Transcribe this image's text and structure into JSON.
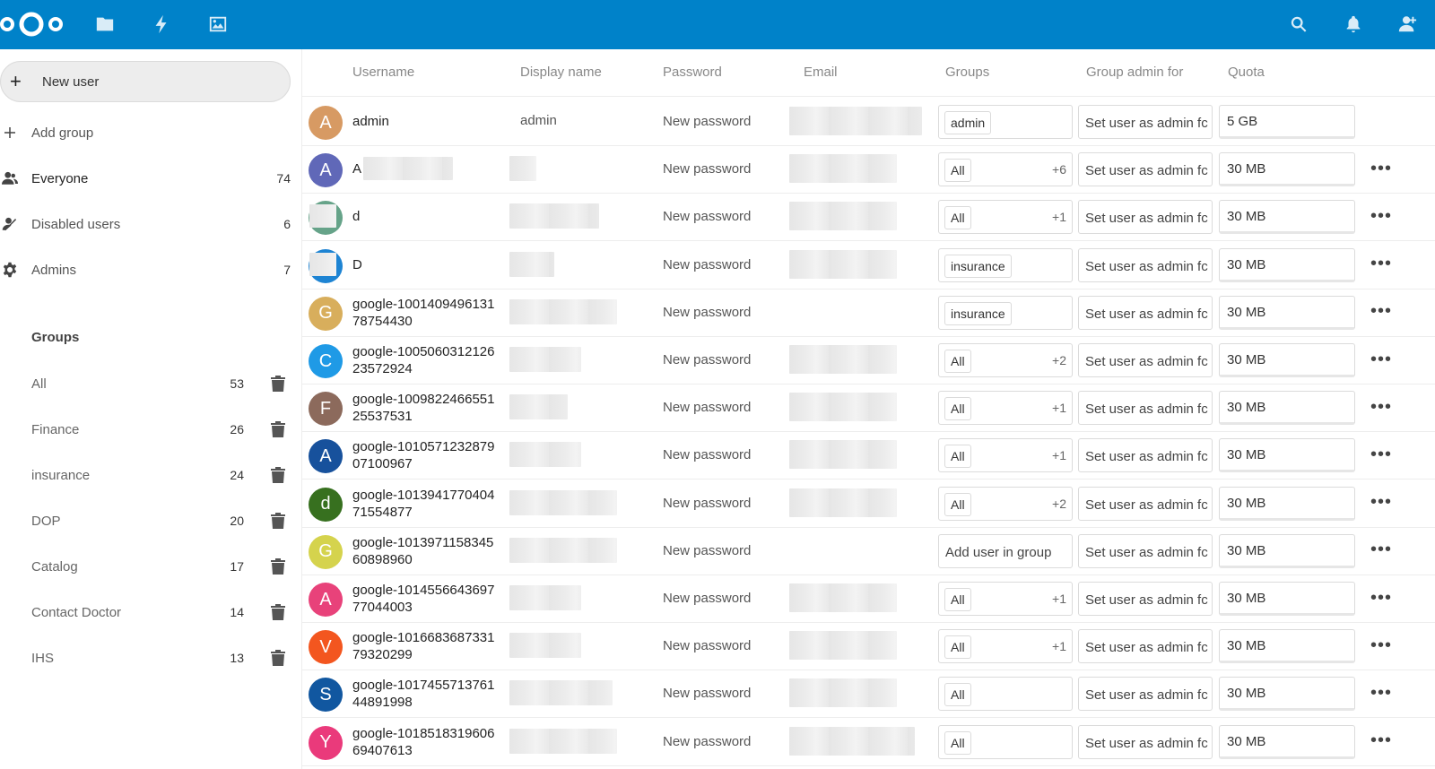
{
  "header": {
    "icons": [
      "nextcloud-logo",
      "files-icon",
      "activity-icon",
      "gallery-icon",
      "search-icon",
      "notifications-icon",
      "contacts-icon"
    ]
  },
  "sidebar": {
    "new_user": "New user",
    "add_group": "Add group",
    "items": [
      {
        "label": "Everyone",
        "count": "74",
        "icon": "user-icon"
      },
      {
        "label": "Disabled users",
        "count": "6",
        "icon": "disabled-user-icon"
      },
      {
        "label": "Admins",
        "count": "7",
        "icon": "gear-icon"
      }
    ],
    "groups_caption": "Groups",
    "groups": [
      {
        "label": "All",
        "count": "53"
      },
      {
        "label": "Finance",
        "count": "26"
      },
      {
        "label": "insurance",
        "count": "24"
      },
      {
        "label": "DOP",
        "count": "20"
      },
      {
        "label": "Catalog",
        "count": "17"
      },
      {
        "label": "Contact Doctor",
        "count": "14"
      },
      {
        "label": "IHS",
        "count": "13"
      }
    ]
  },
  "table": {
    "headers": [
      "Username",
      "Display name",
      "Password",
      "Email",
      "Groups",
      "Group admin for",
      "Quota"
    ],
    "rows": [
      {
        "avatar": "A",
        "color": "#d79a63",
        "user1": "admin",
        "user2": "",
        "display": "admin",
        "password": "New password",
        "group": "admin",
        "more": "",
        "admin": "Set user as admin fc",
        "quota": "5 GB"
      },
      {
        "avatar": "A",
        "color": "#6068b8",
        "user1": "A",
        "user2": "",
        "display": "",
        "password": "New password",
        "group": "All",
        "more": "+6",
        "admin": "Set user as admin fc",
        "quota": "30 MB"
      },
      {
        "avatar": "D",
        "color": "#66a389",
        "user1": "d",
        "user2": "",
        "display": "",
        "password": "New password",
        "group": "All",
        "more": "+1",
        "admin": "Set user as admin fc",
        "quota": "30 MB"
      },
      {
        "avatar": "D",
        "color": "#1e84d3",
        "user1": "D",
        "user2": "",
        "display": "",
        "password": "New password",
        "group": "insurance",
        "more": "",
        "admin": "Set user as admin fc",
        "quota": "30 MB"
      },
      {
        "avatar": "G",
        "color": "#d8ae5c",
        "user1": "google-1001409496131",
        "user2": "78754430",
        "display": "",
        "password": "New password",
        "group": "insurance",
        "more": "",
        "admin": "Set user as admin fc",
        "quota": "30 MB"
      },
      {
        "avatar": "C",
        "color": "#1f9ae6",
        "user1": "google-1005060312126",
        "user2": "23572924",
        "display": "",
        "password": "New password",
        "group": "All",
        "more": "+2",
        "admin": "Set user as admin fc",
        "quota": "30 MB"
      },
      {
        "avatar": "F",
        "color": "#8c6a5c",
        "user1": "google-1009822466551",
        "user2": "25537531",
        "display": "",
        "password": "New password",
        "group": "All",
        "more": "+1",
        "admin": "Set user as admin fc",
        "quota": "30 MB"
      },
      {
        "avatar": "A",
        "color": "#17519c",
        "user1": "google-1010571232879",
        "user2": "07100967",
        "display": "",
        "password": "New password",
        "group": "All",
        "more": "+1",
        "admin": "Set user as admin fc",
        "quota": "30 MB"
      },
      {
        "avatar": "d",
        "color": "#37701f",
        "user1": "google-1013941770404",
        "user2": "71554877",
        "display": "",
        "password": "New password",
        "group": "All",
        "more": "+2",
        "admin": "Set user as admin fc",
        "quota": "30 MB"
      },
      {
        "avatar": "G",
        "color": "#d5d34d",
        "user1": "google-1013971158345",
        "user2": "60898960",
        "display": "",
        "password": "New password",
        "group": "",
        "placeholder": "Add user in group",
        "more": "",
        "admin": "Set user as admin fc",
        "quota": "30 MB"
      },
      {
        "avatar": "A",
        "color": "#e8427a",
        "user1": "google-1014556643697",
        "user2": "77044003",
        "display": "",
        "password": "New password",
        "group": "All",
        "more": "+1",
        "admin": "Set user as admin fc",
        "quota": "30 MB"
      },
      {
        "avatar": "V",
        "color": "#f3561f",
        "user1": "google-1016683687331",
        "user2": "79320299",
        "display": "",
        "password": "New password",
        "group": "All",
        "more": "+1",
        "admin": "Set user as admin fc",
        "quota": "30 MB"
      },
      {
        "avatar": "S",
        "color": "#1157a0",
        "user1": "google-1017455713761",
        "user2": "44891998",
        "display": "",
        "password": "New password",
        "group": "All",
        "more": "",
        "admin": "Set user as admin fc",
        "quota": "30 MB"
      },
      {
        "avatar": "Y",
        "color": "#ea3a7b",
        "user1": "google-1018518319606",
        "user2": "69407613",
        "display": "",
        "password": "New password",
        "group": "All",
        "more": "",
        "admin": "Set user as admin fc",
        "quota": "30 MB"
      }
    ],
    "row_menu": "•••"
  }
}
